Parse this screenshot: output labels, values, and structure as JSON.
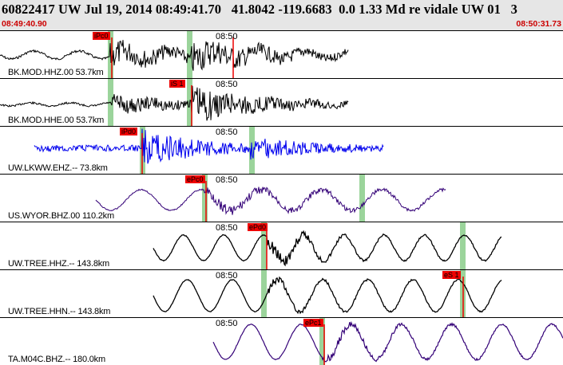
{
  "header": {
    "title": "60822417 UW Jul 19, 2014 08:49:41.70   41.8042 -119.6683  0.0 1.33 Md re vidale UW 01   3",
    "start_time": "08:49:40.90",
    "end_time": "08:50:31.73"
  },
  "colors": {
    "header_bg": "#e6e6e6",
    "time_text": "#cc0000",
    "pick_marker": "#ee0000",
    "window_band": "#9bd49b"
  },
  "panels": [
    {
      "label": "BK.MOD.HHZ.00 53.7km",
      "minute_label": "08:50",
      "pick_label": "iPc0"
    },
    {
      "label": "BK.MOD.HHE.00 53.7km",
      "minute_label": "08:50",
      "pick_label": "iS 1"
    },
    {
      "label": "UW.LKWW.EHZ.-- 73.8km",
      "minute_label": "08:50",
      "pick_label": "iPd0"
    },
    {
      "label": "US.WYOR.BHZ.00 110.2km",
      "minute_label": "08:50",
      "pick_label": "ePc0"
    },
    {
      "label": "UW.TREE.HHZ.-- 143.8km",
      "minute_label": "08:50",
      "pick_label": "ePd0"
    },
    {
      "label": "UW.TREE.HHN.-- 143.8km",
      "minute_label": "08:50",
      "pick_label": "eS 1"
    },
    {
      "label": "TA.M04C.BHZ.-- 180.0km",
      "minute_label": "08:50",
      "pick_label": "ePc1"
    }
  ]
}
